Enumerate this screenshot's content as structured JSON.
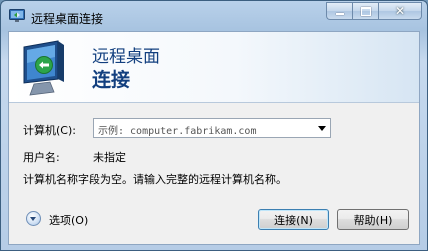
{
  "window": {
    "title": "远程桌面连接",
    "icons": {
      "app": "remote-desktop-icon",
      "minimize": "minimize-icon",
      "maximize": "maximize-icon",
      "close": "close-icon"
    }
  },
  "banner": {
    "line1": "远程桌面",
    "line2": "连接",
    "icon": "remote-desktop-monitor-icon"
  },
  "form": {
    "computer_label": "计算机(C):",
    "computer_value": "示例: computer.fabrikam.com",
    "user_label": "用户名:",
    "user_value": "未指定",
    "message": "计算机名称字段为空。请输入完整的远程计算机名称。"
  },
  "footer": {
    "options_label": "选项(O)",
    "connect_label": "连接(N)",
    "help_label": "帮助(H)"
  },
  "colors": {
    "banner_text": "#123f7f",
    "frame": "#b9d1ea",
    "body_bg": "#f0f0f0"
  }
}
